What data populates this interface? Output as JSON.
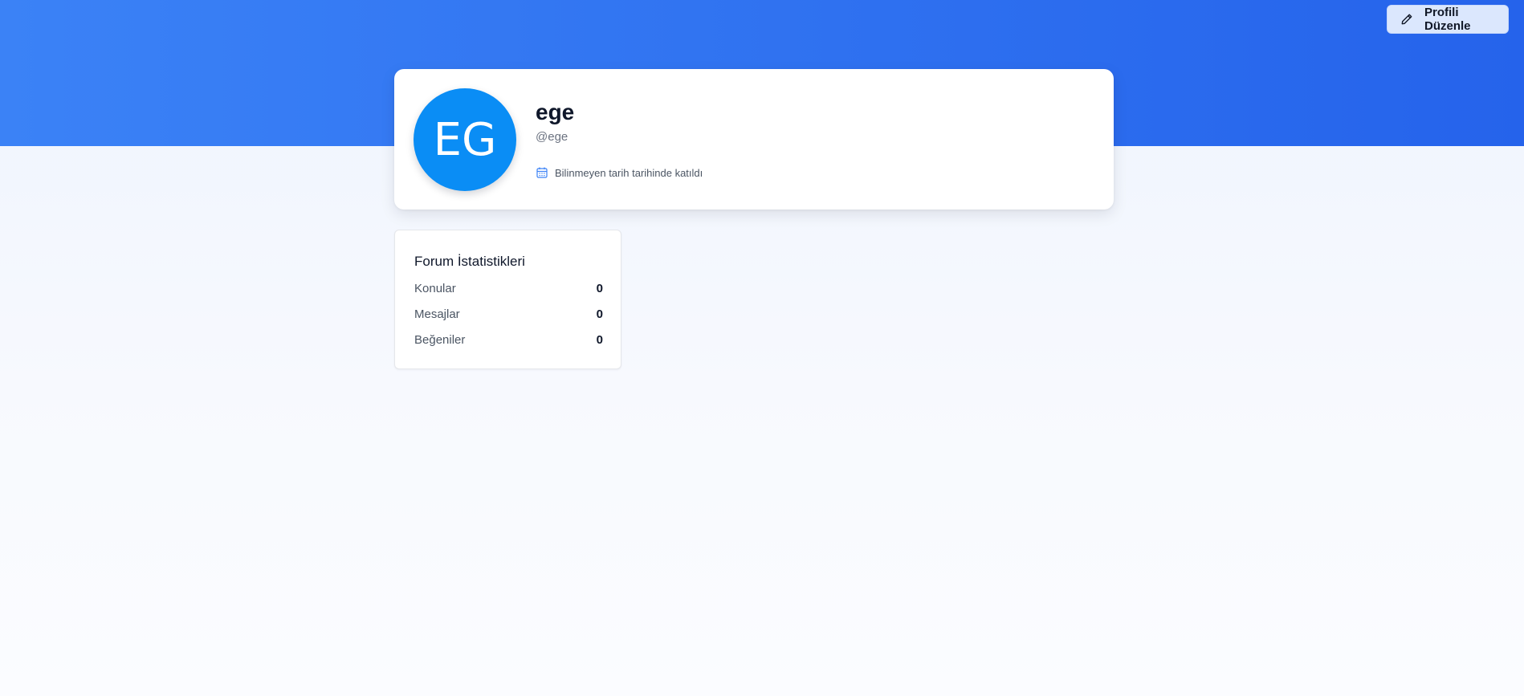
{
  "header": {
    "edit_profile_label": "Profili Düzenle"
  },
  "profile": {
    "avatar_initials": "EG",
    "display_name": "ege",
    "handle": "@ege",
    "joined_text": "Bilinmeyen tarih tarihinde katıldı"
  },
  "stats": {
    "title": "Forum İstatistikleri",
    "items": [
      {
        "label": "Konular",
        "value": "0"
      },
      {
        "label": "Mesajlar",
        "value": "0"
      },
      {
        "label": "Beğeniler",
        "value": "0"
      }
    ]
  },
  "colors": {
    "cover": "#2563eb",
    "avatar": "#0a8df5",
    "accent_icon": "#3b82f6"
  },
  "icons": {
    "edit": "pencil-icon",
    "joined": "calendar-icon"
  }
}
